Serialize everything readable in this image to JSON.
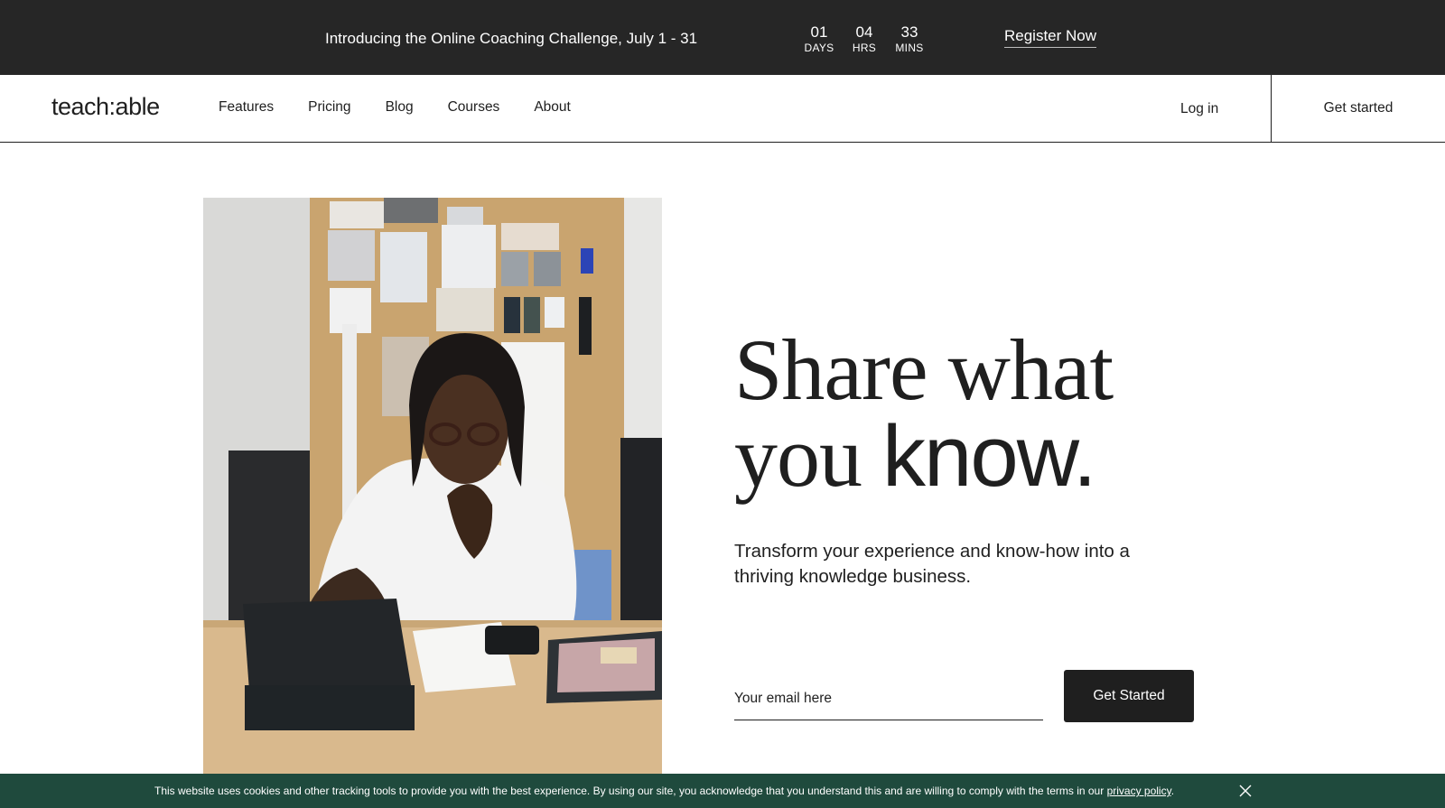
{
  "promo": {
    "text": "Introducing the Online Coaching Challenge, July 1 - 31",
    "countdown": [
      {
        "value": "01",
        "label": "DAYS"
      },
      {
        "value": "04",
        "label": "HRS"
      },
      {
        "value": "33",
        "label": "MINS"
      }
    ],
    "cta": "Register Now",
    "background": "#262626"
  },
  "header": {
    "logo": "teach:able",
    "nav": [
      "Features",
      "Pricing",
      "Blog",
      "Courses",
      "About"
    ],
    "login": "Log in",
    "get_started": "Get started"
  },
  "hero": {
    "headline_line1": "Share what",
    "headline_line2_serif": "you ",
    "headline_line2_sans": "know.",
    "subhead": "Transform your experience and know-how into a thriving knowledge business.",
    "email_placeholder": "Your email here",
    "cta": "Get Started",
    "image_icon": "photo-man-working-on-tablet"
  },
  "cookie_bar": {
    "text": "This website uses cookies and other tracking tools to provide you with the best experience. By using our site, you acknowledge that you understand this and are willing to comply with the terms in our ",
    "link": "privacy policy",
    "suffix": ".",
    "close_icon": "close-icon",
    "background": "#1f4a3d"
  }
}
